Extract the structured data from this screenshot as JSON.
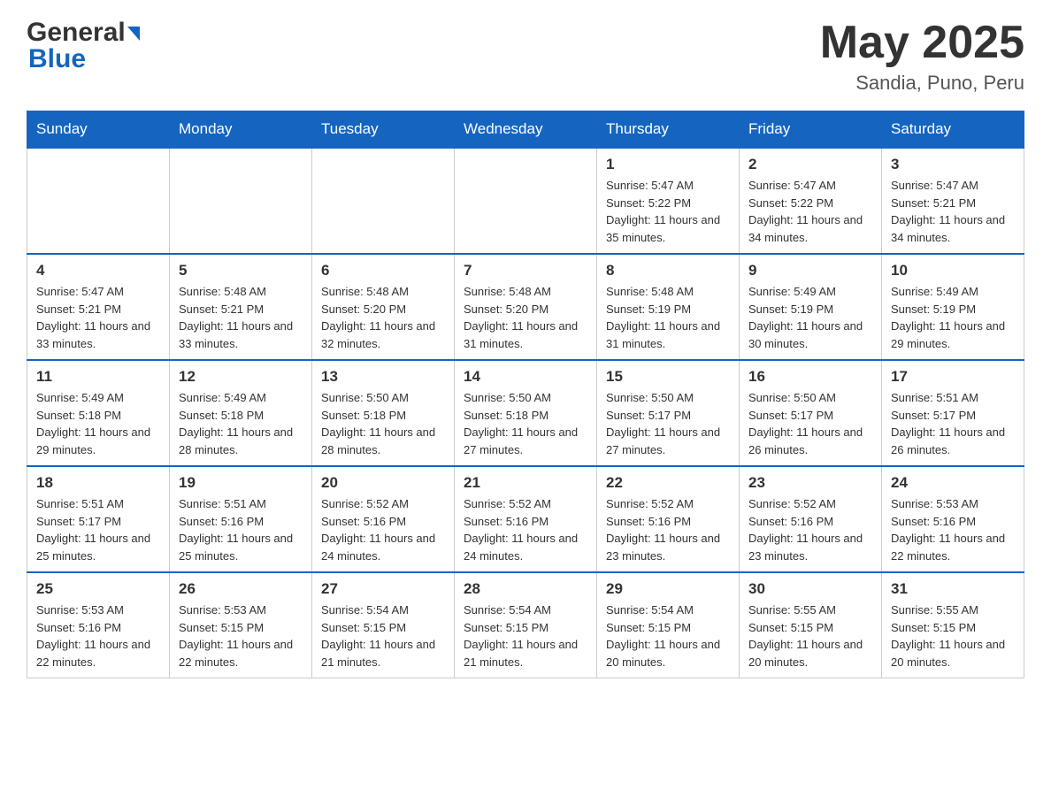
{
  "header": {
    "title": "May 2025",
    "subtitle": "Sandia, Puno, Peru",
    "logo_general": "General",
    "logo_blue": "Blue"
  },
  "days_of_week": [
    "Sunday",
    "Monday",
    "Tuesday",
    "Wednesday",
    "Thursday",
    "Friday",
    "Saturday"
  ],
  "weeks": [
    [
      {
        "day": "",
        "sunrise": "",
        "sunset": "",
        "daylight": ""
      },
      {
        "day": "",
        "sunrise": "",
        "sunset": "",
        "daylight": ""
      },
      {
        "day": "",
        "sunrise": "",
        "sunset": "",
        "daylight": ""
      },
      {
        "day": "",
        "sunrise": "",
        "sunset": "",
        "daylight": ""
      },
      {
        "day": "1",
        "sunrise": "Sunrise: 5:47 AM",
        "sunset": "Sunset: 5:22 PM",
        "daylight": "Daylight: 11 hours and 35 minutes."
      },
      {
        "day": "2",
        "sunrise": "Sunrise: 5:47 AM",
        "sunset": "Sunset: 5:22 PM",
        "daylight": "Daylight: 11 hours and 34 minutes."
      },
      {
        "day": "3",
        "sunrise": "Sunrise: 5:47 AM",
        "sunset": "Sunset: 5:21 PM",
        "daylight": "Daylight: 11 hours and 34 minutes."
      }
    ],
    [
      {
        "day": "4",
        "sunrise": "Sunrise: 5:47 AM",
        "sunset": "Sunset: 5:21 PM",
        "daylight": "Daylight: 11 hours and 33 minutes."
      },
      {
        "day": "5",
        "sunrise": "Sunrise: 5:48 AM",
        "sunset": "Sunset: 5:21 PM",
        "daylight": "Daylight: 11 hours and 33 minutes."
      },
      {
        "day": "6",
        "sunrise": "Sunrise: 5:48 AM",
        "sunset": "Sunset: 5:20 PM",
        "daylight": "Daylight: 11 hours and 32 minutes."
      },
      {
        "day": "7",
        "sunrise": "Sunrise: 5:48 AM",
        "sunset": "Sunset: 5:20 PM",
        "daylight": "Daylight: 11 hours and 31 minutes."
      },
      {
        "day": "8",
        "sunrise": "Sunrise: 5:48 AM",
        "sunset": "Sunset: 5:19 PM",
        "daylight": "Daylight: 11 hours and 31 minutes."
      },
      {
        "day": "9",
        "sunrise": "Sunrise: 5:49 AM",
        "sunset": "Sunset: 5:19 PM",
        "daylight": "Daylight: 11 hours and 30 minutes."
      },
      {
        "day": "10",
        "sunrise": "Sunrise: 5:49 AM",
        "sunset": "Sunset: 5:19 PM",
        "daylight": "Daylight: 11 hours and 29 minutes."
      }
    ],
    [
      {
        "day": "11",
        "sunrise": "Sunrise: 5:49 AM",
        "sunset": "Sunset: 5:18 PM",
        "daylight": "Daylight: 11 hours and 29 minutes."
      },
      {
        "day": "12",
        "sunrise": "Sunrise: 5:49 AM",
        "sunset": "Sunset: 5:18 PM",
        "daylight": "Daylight: 11 hours and 28 minutes."
      },
      {
        "day": "13",
        "sunrise": "Sunrise: 5:50 AM",
        "sunset": "Sunset: 5:18 PM",
        "daylight": "Daylight: 11 hours and 28 minutes."
      },
      {
        "day": "14",
        "sunrise": "Sunrise: 5:50 AM",
        "sunset": "Sunset: 5:18 PM",
        "daylight": "Daylight: 11 hours and 27 minutes."
      },
      {
        "day": "15",
        "sunrise": "Sunrise: 5:50 AM",
        "sunset": "Sunset: 5:17 PM",
        "daylight": "Daylight: 11 hours and 27 minutes."
      },
      {
        "day": "16",
        "sunrise": "Sunrise: 5:50 AM",
        "sunset": "Sunset: 5:17 PM",
        "daylight": "Daylight: 11 hours and 26 minutes."
      },
      {
        "day": "17",
        "sunrise": "Sunrise: 5:51 AM",
        "sunset": "Sunset: 5:17 PM",
        "daylight": "Daylight: 11 hours and 26 minutes."
      }
    ],
    [
      {
        "day": "18",
        "sunrise": "Sunrise: 5:51 AM",
        "sunset": "Sunset: 5:17 PM",
        "daylight": "Daylight: 11 hours and 25 minutes."
      },
      {
        "day": "19",
        "sunrise": "Sunrise: 5:51 AM",
        "sunset": "Sunset: 5:16 PM",
        "daylight": "Daylight: 11 hours and 25 minutes."
      },
      {
        "day": "20",
        "sunrise": "Sunrise: 5:52 AM",
        "sunset": "Sunset: 5:16 PM",
        "daylight": "Daylight: 11 hours and 24 minutes."
      },
      {
        "day": "21",
        "sunrise": "Sunrise: 5:52 AM",
        "sunset": "Sunset: 5:16 PM",
        "daylight": "Daylight: 11 hours and 24 minutes."
      },
      {
        "day": "22",
        "sunrise": "Sunrise: 5:52 AM",
        "sunset": "Sunset: 5:16 PM",
        "daylight": "Daylight: 11 hours and 23 minutes."
      },
      {
        "day": "23",
        "sunrise": "Sunrise: 5:52 AM",
        "sunset": "Sunset: 5:16 PM",
        "daylight": "Daylight: 11 hours and 23 minutes."
      },
      {
        "day": "24",
        "sunrise": "Sunrise: 5:53 AM",
        "sunset": "Sunset: 5:16 PM",
        "daylight": "Daylight: 11 hours and 22 minutes."
      }
    ],
    [
      {
        "day": "25",
        "sunrise": "Sunrise: 5:53 AM",
        "sunset": "Sunset: 5:16 PM",
        "daylight": "Daylight: 11 hours and 22 minutes."
      },
      {
        "day": "26",
        "sunrise": "Sunrise: 5:53 AM",
        "sunset": "Sunset: 5:15 PM",
        "daylight": "Daylight: 11 hours and 22 minutes."
      },
      {
        "day": "27",
        "sunrise": "Sunrise: 5:54 AM",
        "sunset": "Sunset: 5:15 PM",
        "daylight": "Daylight: 11 hours and 21 minutes."
      },
      {
        "day": "28",
        "sunrise": "Sunrise: 5:54 AM",
        "sunset": "Sunset: 5:15 PM",
        "daylight": "Daylight: 11 hours and 21 minutes."
      },
      {
        "day": "29",
        "sunrise": "Sunrise: 5:54 AM",
        "sunset": "Sunset: 5:15 PM",
        "daylight": "Daylight: 11 hours and 20 minutes."
      },
      {
        "day": "30",
        "sunrise": "Sunrise: 5:55 AM",
        "sunset": "Sunset: 5:15 PM",
        "daylight": "Daylight: 11 hours and 20 minutes."
      },
      {
        "day": "31",
        "sunrise": "Sunrise: 5:55 AM",
        "sunset": "Sunset: 5:15 PM",
        "daylight": "Daylight: 11 hours and 20 minutes."
      }
    ]
  ]
}
